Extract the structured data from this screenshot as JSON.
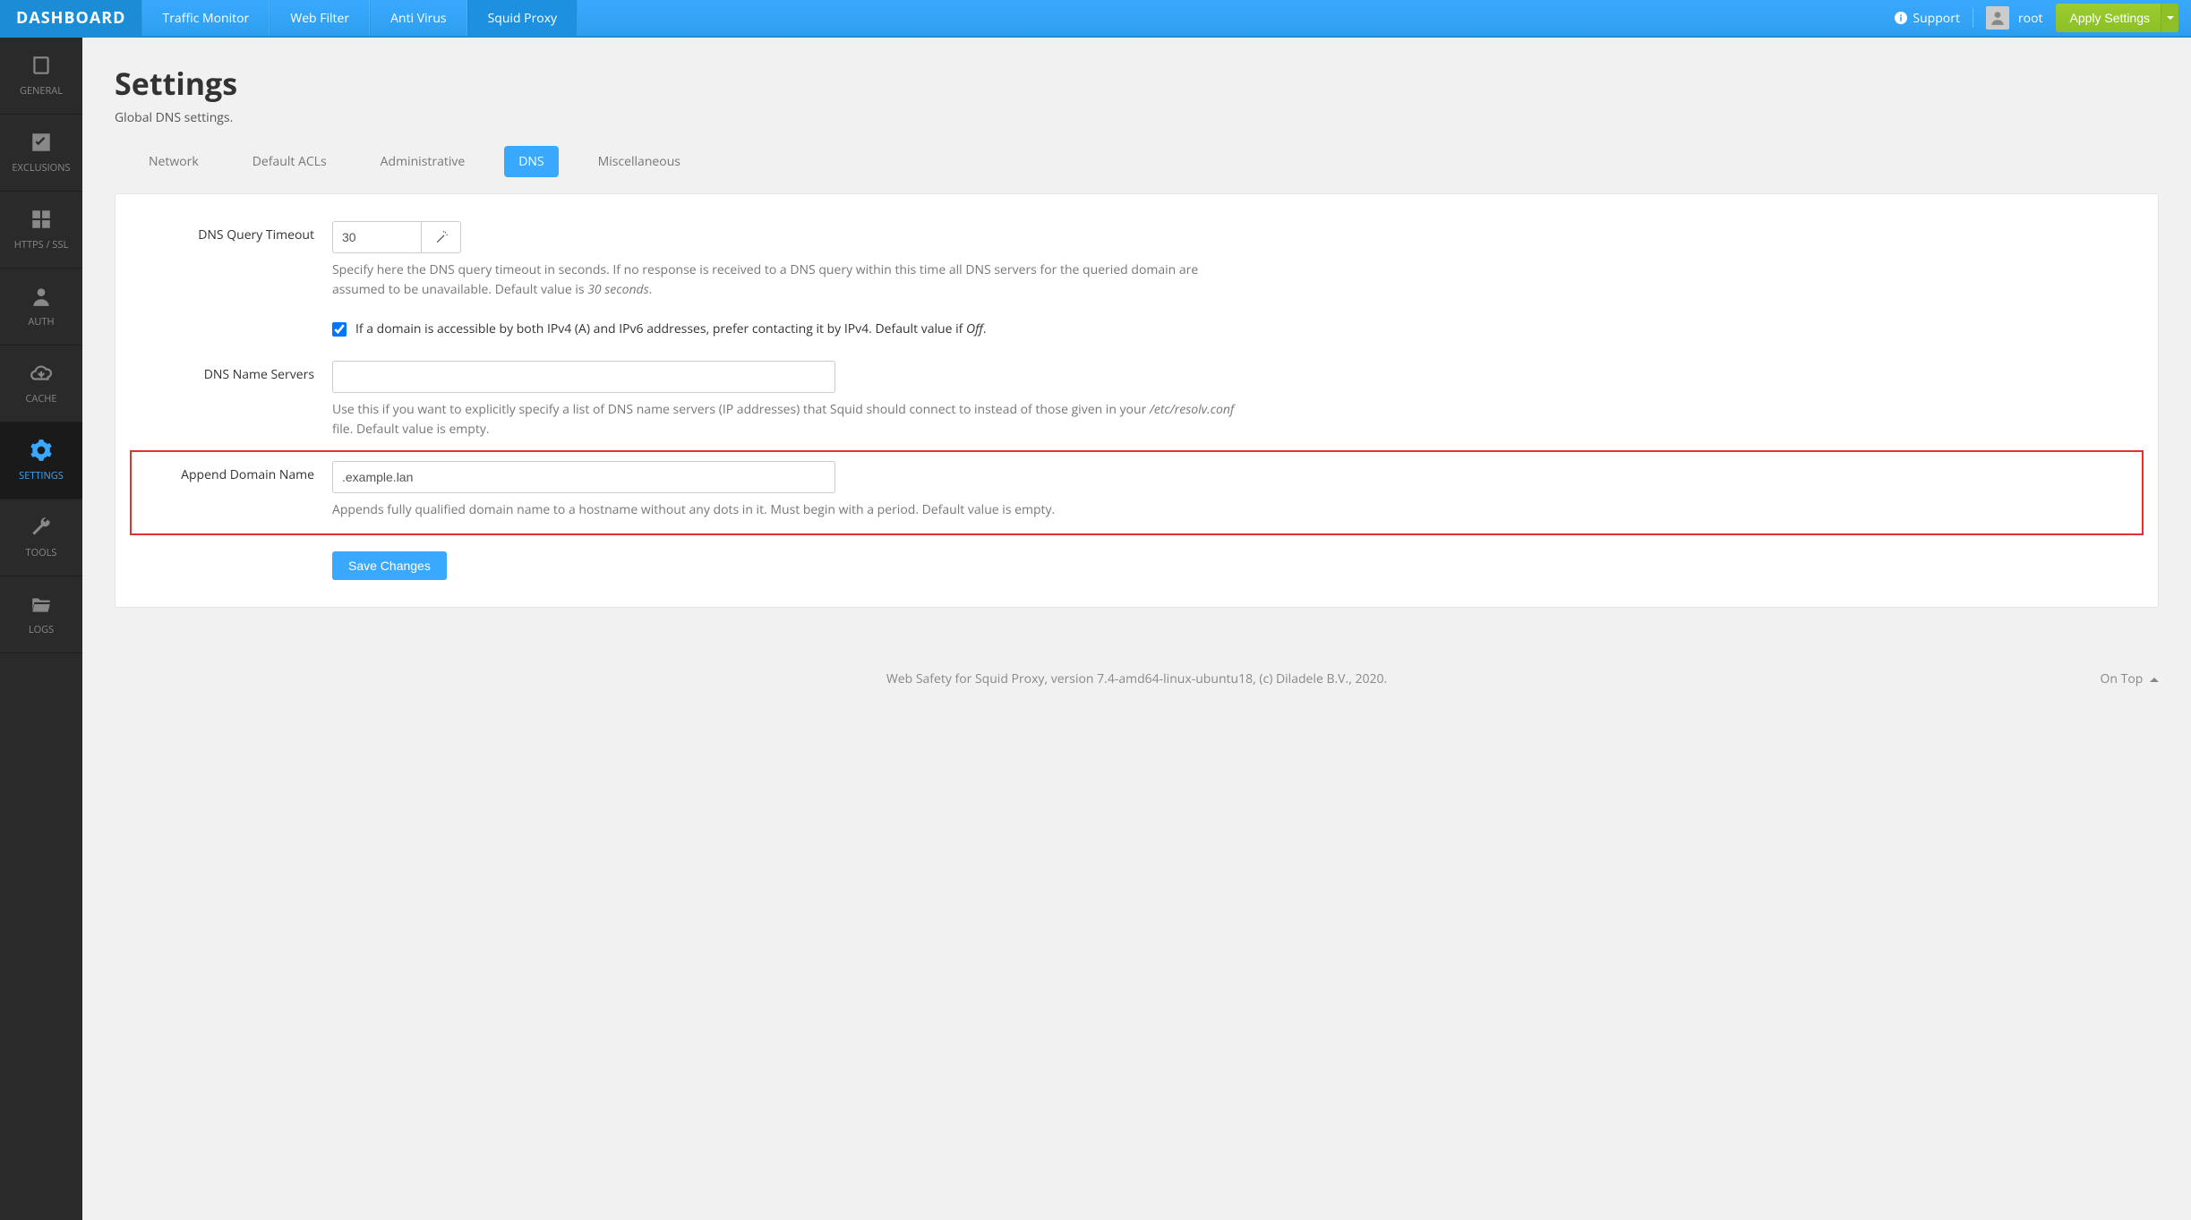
{
  "brand": "DASHBOARD",
  "topnav": {
    "items": [
      {
        "label": "Traffic Monitor",
        "active": false
      },
      {
        "label": "Web Filter",
        "active": false
      },
      {
        "label": "Anti Virus",
        "active": false
      },
      {
        "label": "Squid Proxy",
        "active": true
      }
    ],
    "support": "Support",
    "username": "root",
    "apply_label": "Apply Settings"
  },
  "sidebar": {
    "items": [
      {
        "label": "GENERAL",
        "icon": "book-icon"
      },
      {
        "label": "EXCLUSIONS",
        "icon": "check-square-icon"
      },
      {
        "label": "HTTPS / SSL",
        "icon": "grid-icon"
      },
      {
        "label": "AUTH",
        "icon": "user-icon"
      },
      {
        "label": "CACHE",
        "icon": "cloud-download-icon"
      },
      {
        "label": "SETTINGS",
        "icon": "gear-icon",
        "active": true
      },
      {
        "label": "TOOLS",
        "icon": "wrench-icon"
      },
      {
        "label": "LOGS",
        "icon": "folder-open-icon"
      }
    ]
  },
  "page": {
    "title": "Settings",
    "subtitle": "Global DNS settings."
  },
  "tabs": [
    {
      "label": "Network"
    },
    {
      "label": "Default ACLs"
    },
    {
      "label": "Administrative"
    },
    {
      "label": "DNS",
      "active": true
    },
    {
      "label": "Miscellaneous"
    }
  ],
  "form": {
    "dns_timeout": {
      "label": "DNS Query Timeout",
      "value": "30",
      "help_a": "Specify here the DNS query timeout in seconds. If no response is received to a DNS query within this time all DNS servers for the queried domain are assumed to be unavailable. Default value is ",
      "help_em": "30 seconds",
      "help_b": "."
    },
    "ipv4_pref": {
      "checked": true,
      "label_a": "If a domain is accessible by both IPv4 (A) and IPv6 addresses, prefer contacting it by IPv4. Default value if ",
      "label_em": "Off",
      "label_b": "."
    },
    "dns_nameservers": {
      "label": "DNS Name Servers",
      "value": "",
      "help_a": "Use this if you want to explicitly specify a list of DNS name servers (IP addresses) that Squid should connect to instead of those given in your ",
      "help_em": "/etc/resolv.conf",
      "help_b": " file. Default value is empty."
    },
    "append_domain": {
      "label": "Append Domain Name",
      "value": ".example.lan",
      "help": "Appends fully qualified domain name to a hostname without any dots in it. Must begin with a period. Default value is empty."
    },
    "save_label": "Save Changes"
  },
  "footer": {
    "text": "Web Safety for Squid Proxy, version 7.4-amd64-linux-ubuntu18, (c) Diladele B.V., 2020.",
    "ontop": "On Top"
  }
}
